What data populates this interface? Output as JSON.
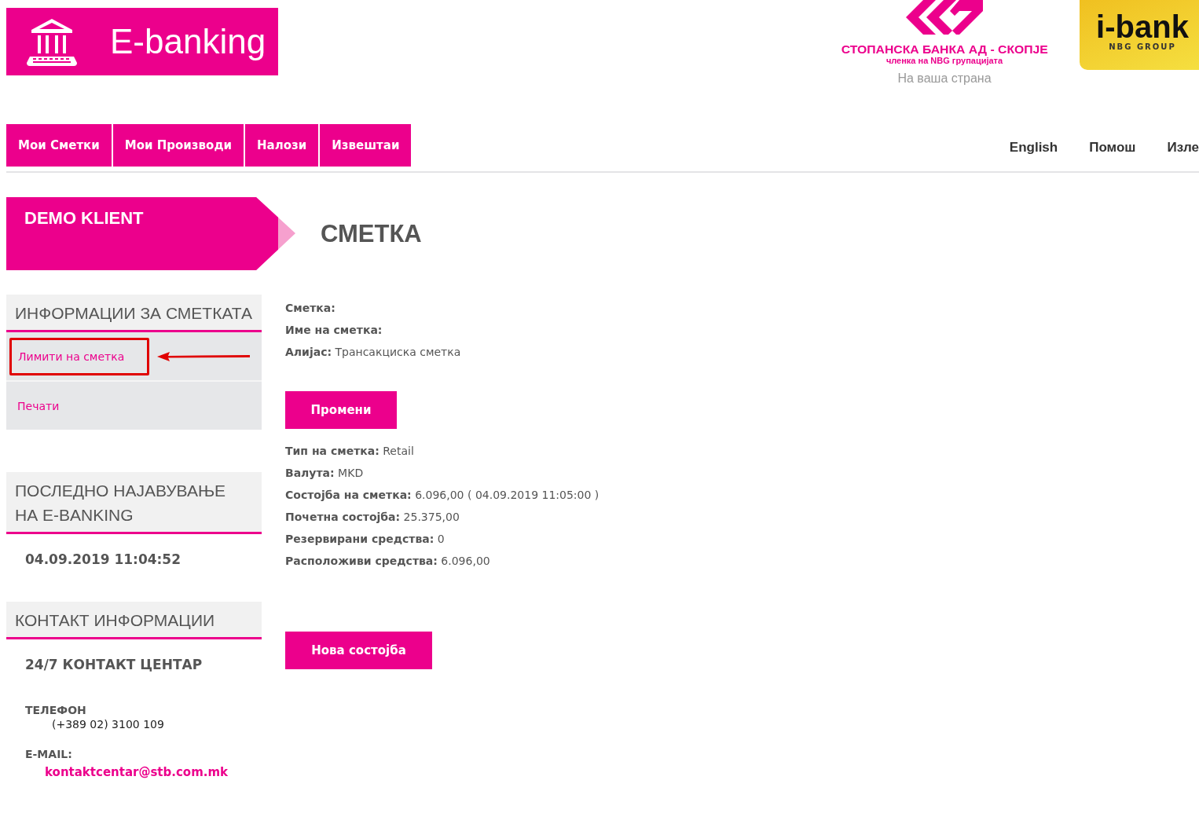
{
  "header": {
    "logo_text": "E-banking",
    "bank": {
      "name": "СТОПАНСКА БАНКА АД - СКОПЈЕ",
      "subtitle": "членка на NBG групацијата",
      "slogan": "На ваша страна"
    },
    "ibank": {
      "brand": "i-bank",
      "group": "NBG GROUP"
    }
  },
  "nav": {
    "items": [
      {
        "label": "Мои Сметки"
      },
      {
        "label": "Мои Производи"
      },
      {
        "label": "Налози"
      },
      {
        "label": "Извештаи"
      }
    ],
    "utility_links": [
      "English",
      "Помош",
      "Изле"
    ]
  },
  "client_banner": "DEMO KLIENT",
  "page_title": "СМЕТКА",
  "sidebar": [
    {
      "kind": "links",
      "title": "ИНФОРМАЦИИ ЗА СМЕТКАТА",
      "links": [
        {
          "label": "Лимити на сметка",
          "highlighted": true
        },
        {
          "label": "Печати",
          "highlighted": false
        }
      ]
    },
    {
      "kind": "value",
      "title": "ПОСЛЕДНО НАЈАВУВАЊЕ НА E-BANKING",
      "value": "04.09.2019 11:04:52"
    },
    {
      "kind": "contact",
      "title": "КОНТАКТ ИНФОРМАЦИИ",
      "center": "24/7 КОНТАКТ ЦЕНТАР",
      "phone_label": "ТЕЛЕФОН",
      "phone": "(+389 02) 3100 109",
      "email_label": "E-MAIL:",
      "email": "kontaktcentar@stb.com.mk"
    }
  ],
  "account": {
    "fields_top": [
      {
        "label": "Сметка:"
      },
      {
        "label": "Име на сметка:"
      },
      {
        "label": "Алијас:",
        "value": "Трансакциска сметка"
      }
    ],
    "change_button": "Промени",
    "fields_bottom": [
      {
        "label": "Тип на сметка:",
        "value": "Retail"
      },
      {
        "label": "Валута:",
        "value": "MKD"
      },
      {
        "label": "Состојба на сметка:",
        "value": "6.096,00 ( 04.09.2019 11:05:00 )"
      },
      {
        "label": "Почетна состојба:",
        "value": "25.375,00"
      },
      {
        "label": "Резервирани средства:",
        "value": "0"
      },
      {
        "label": "Расположиви средства:",
        "value": "6.096,00"
      }
    ],
    "new_balance_button": "Нова состојба"
  }
}
